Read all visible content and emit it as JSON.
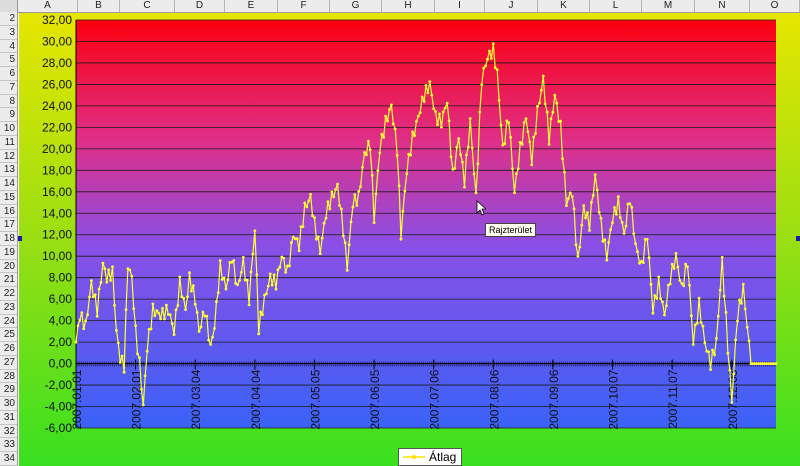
{
  "spreadsheet": {
    "columns": [
      "A",
      "B",
      "C",
      "D",
      "E",
      "F",
      "G",
      "H",
      "I",
      "J",
      "K",
      "L",
      "M",
      "N",
      "O"
    ],
    "rows": [
      "2",
      "3",
      "4",
      "5",
      "6",
      "7",
      "8",
      "9",
      "10",
      "11",
      "12",
      "13",
      "14",
      "15",
      "16",
      "17",
      "18",
      "19",
      "20",
      "21",
      "22",
      "23",
      "24",
      "25",
      "26",
      "27",
      "28",
      "29",
      "30",
      "31",
      "32",
      "33",
      "34"
    ]
  },
  "tooltip": "Rajzterület",
  "chart_data": {
    "type": "line",
    "title": "",
    "xlabel": "",
    "ylabel": "",
    "ylim": [
      -6,
      32
    ],
    "y_ticks": [
      "32,00",
      "30,00",
      "28,00",
      "26,00",
      "24,00",
      "22,00",
      "20,00",
      "18,00",
      "16,00",
      "14,00",
      "12,00",
      "10,00",
      "8,00",
      "6,00",
      "4,00",
      "2,00",
      "0,00",
      "-2,00",
      "-4,00",
      "-6,00"
    ],
    "x_tick_labels": [
      "2007.01.01",
      "2007.02.01",
      "2007.03.04",
      "2007.04.04",
      "2007.05.05",
      "2007.06.05",
      "2007.07.06",
      "2007.08.06",
      "2007.09.06",
      "2007.10.07",
      "2007.11.07",
      "2007.12.08"
    ],
    "grid": true,
    "legend_position": "bottom",
    "background_gradient": [
      "#fb0010",
      "#8a4fe6",
      "#3a62f8"
    ],
    "outer_gradient": [
      "#e6e600",
      "#38e020"
    ],
    "series": [
      {
        "name": "Átlag",
        "color": "#ffff33",
        "start": "2007-01-01",
        "end": "2007-12-31",
        "keypoints": [
          [
            "2007-01-01",
            2.0
          ],
          [
            "2007-01-03",
            4.5
          ],
          [
            "2007-01-06",
            3.5
          ],
          [
            "2007-01-09",
            7.5
          ],
          [
            "2007-01-12",
            5.0
          ],
          [
            "2007-01-15",
            9.3
          ],
          [
            "2007-01-17",
            8.0
          ],
          [
            "2007-01-20",
            8.5
          ],
          [
            "2007-01-22",
            3.0
          ],
          [
            "2007-01-24",
            0.5
          ],
          [
            "2007-01-26",
            -0.2
          ],
          [
            "2007-01-28",
            9.2
          ],
          [
            "2007-01-30",
            8.0
          ],
          [
            "2007-02-01",
            3.0
          ],
          [
            "2007-02-03",
            0.0
          ],
          [
            "2007-02-05",
            -4.0
          ],
          [
            "2007-02-07",
            1.5
          ],
          [
            "2007-02-10",
            5.0
          ],
          [
            "2007-02-14",
            4.5
          ],
          [
            "2007-02-18",
            5.0
          ],
          [
            "2007-02-21",
            3.0
          ],
          [
            "2007-02-24",
            7.5
          ],
          [
            "2007-02-27",
            5.0
          ],
          [
            "2007-03-01",
            8.0
          ],
          [
            "2007-03-04",
            6.0
          ],
          [
            "2007-03-06",
            3.0
          ],
          [
            "2007-03-09",
            5.0
          ],
          [
            "2007-03-12",
            1.5
          ],
          [
            "2007-03-14",
            3.5
          ],
          [
            "2007-03-17",
            9.0
          ],
          [
            "2007-03-20",
            7.0
          ],
          [
            "2007-03-23",
            10.0
          ],
          [
            "2007-03-26",
            7.0
          ],
          [
            "2007-03-29",
            9.5
          ],
          [
            "2007-04-01",
            6.0
          ],
          [
            "2007-04-04",
            12.5
          ],
          [
            "2007-04-06",
            3.3
          ],
          [
            "2007-04-09",
            6.0
          ],
          [
            "2007-04-12",
            8.0
          ],
          [
            "2007-04-15",
            7.5
          ],
          [
            "2007-04-18",
            10.0
          ],
          [
            "2007-04-21",
            8.5
          ],
          [
            "2007-04-24",
            12.0
          ],
          [
            "2007-04-27",
            11.0
          ],
          [
            "2007-04-30",
            14.5
          ],
          [
            "2007-05-03",
            15.5
          ],
          [
            "2007-05-05",
            13.0
          ],
          [
            "2007-05-08",
            10.5
          ],
          [
            "2007-05-11",
            14.0
          ],
          [
            "2007-05-14",
            15.5
          ],
          [
            "2007-05-17",
            16.5
          ],
          [
            "2007-05-20",
            12.5
          ],
          [
            "2007-05-22",
            9.0
          ],
          [
            "2007-05-25",
            15.0
          ],
          [
            "2007-05-28",
            15.5
          ],
          [
            "2007-05-31",
            19.5
          ],
          [
            "2007-06-03",
            20.5
          ],
          [
            "2007-06-05",
            13.5
          ],
          [
            "2007-06-08",
            20.0
          ],
          [
            "2007-06-11",
            22.5
          ],
          [
            "2007-06-14",
            24.0
          ],
          [
            "2007-06-17",
            20.0
          ],
          [
            "2007-06-19",
            12.0
          ],
          [
            "2007-06-22",
            18.0
          ],
          [
            "2007-06-25",
            21.0
          ],
          [
            "2007-06-28",
            23.0
          ],
          [
            "2007-07-01",
            25.0
          ],
          [
            "2007-07-04",
            26.0
          ],
          [
            "2007-07-07",
            23.0
          ],
          [
            "2007-07-10",
            22.5
          ],
          [
            "2007-07-13",
            24.5
          ],
          [
            "2007-07-16",
            17.5
          ],
          [
            "2007-07-19",
            21.0
          ],
          [
            "2007-07-22",
            17.0
          ],
          [
            "2007-07-25",
            22.5
          ],
          [
            "2007-07-28",
            15.5
          ],
          [
            "2007-07-31",
            26.5
          ],
          [
            "2007-08-03",
            28.5
          ],
          [
            "2007-08-06",
            29.2
          ],
          [
            "2007-08-08",
            27.0
          ],
          [
            "2007-08-11",
            20.0
          ],
          [
            "2007-08-14",
            23.0
          ],
          [
            "2007-08-17",
            16.0
          ],
          [
            "2007-08-20",
            20.0
          ],
          [
            "2007-08-23",
            23.0
          ],
          [
            "2007-08-26",
            19.0
          ],
          [
            "2007-08-29",
            23.5
          ],
          [
            "2007-09-01",
            26.5
          ],
          [
            "2007-09-04",
            21.0
          ],
          [
            "2007-09-07",
            25.0
          ],
          [
            "2007-09-10",
            22.0
          ],
          [
            "2007-09-13",
            15.0
          ],
          [
            "2007-09-16",
            16.0
          ],
          [
            "2007-09-19",
            9.5
          ],
          [
            "2007-09-22",
            14.5
          ],
          [
            "2007-09-25",
            13.0
          ],
          [
            "2007-09-28",
            17.5
          ],
          [
            "2007-10-01",
            13.0
          ],
          [
            "2007-10-04",
            10.0
          ],
          [
            "2007-10-07",
            13.5
          ],
          [
            "2007-10-10",
            15.0
          ],
          [
            "2007-10-13",
            12.0
          ],
          [
            "2007-10-16",
            15.5
          ],
          [
            "2007-10-19",
            11.0
          ],
          [
            "2007-10-22",
            9.0
          ],
          [
            "2007-10-25",
            12.0
          ],
          [
            "2007-10-28",
            5.0
          ],
          [
            "2007-10-31",
            7.5
          ],
          [
            "2007-11-03",
            4.5
          ],
          [
            "2007-11-06",
            8.0
          ],
          [
            "2007-11-09",
            10.0
          ],
          [
            "2007-11-12",
            7.0
          ],
          [
            "2007-11-15",
            9.5
          ],
          [
            "2007-11-18",
            2.0
          ],
          [
            "2007-11-21",
            5.5
          ],
          [
            "2007-11-24",
            2.0
          ],
          [
            "2007-11-27",
            0.0
          ],
          [
            "2007-11-30",
            2.0
          ],
          [
            "2007-12-03",
            9.5
          ],
          [
            "2007-12-06",
            1.5
          ],
          [
            "2007-12-08",
            -3.5
          ],
          [
            "2007-12-11",
            4.5
          ],
          [
            "2007-12-14",
            7.0
          ],
          [
            "2007-12-16",
            3.5
          ],
          [
            "2007-12-18",
            0.0
          ],
          [
            "2007-12-31",
            0.0
          ]
        ]
      }
    ]
  }
}
